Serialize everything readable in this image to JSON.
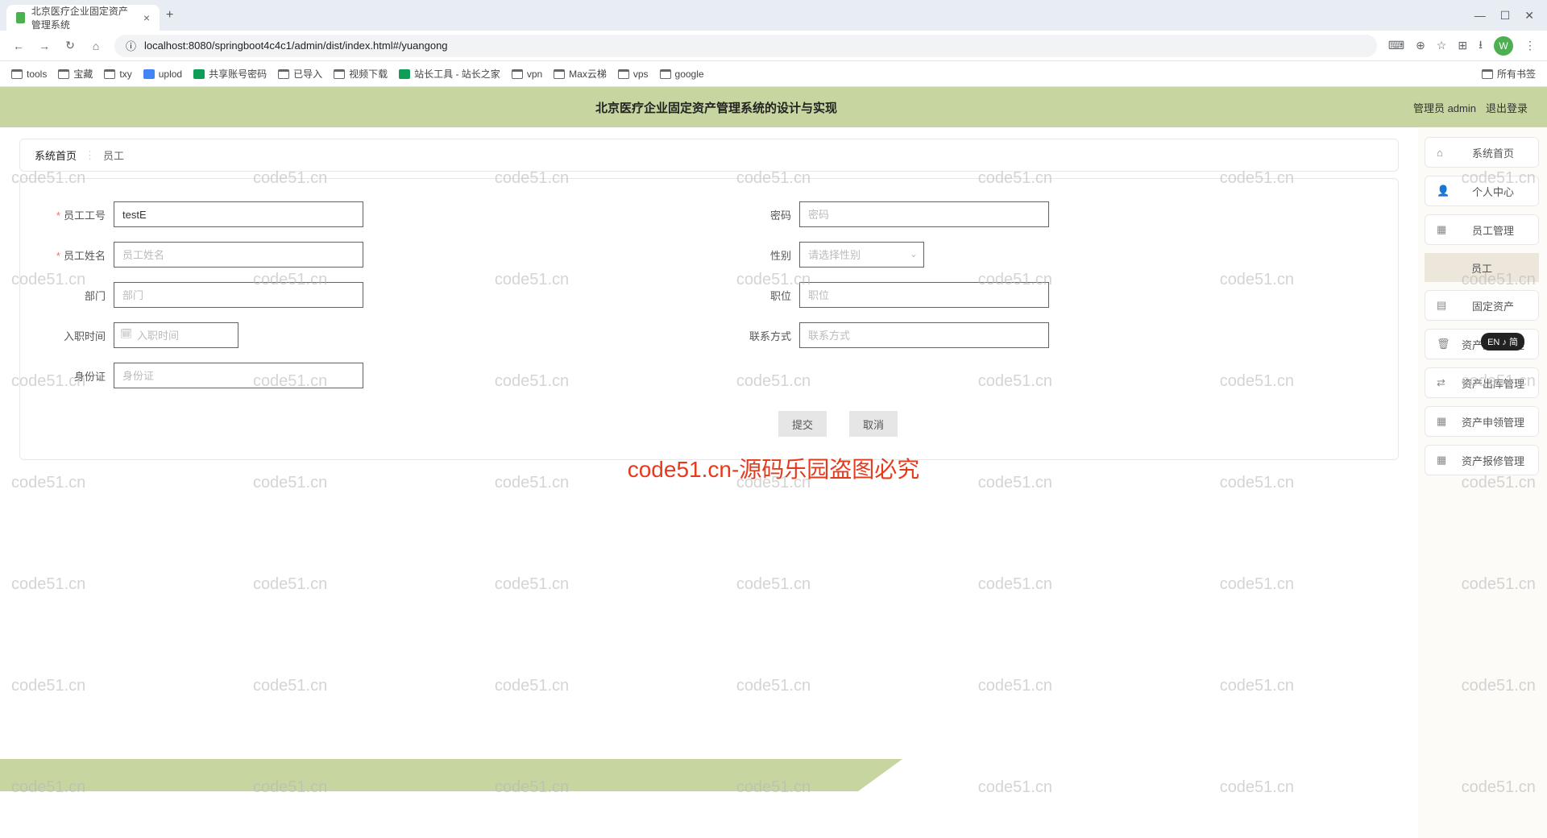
{
  "browser": {
    "tab_title": "北京医疗企业固定资产管理系统",
    "url": "localhost:8080/springboot4c4c1/admin/dist/index.html#/yuangong",
    "avatar_letter": "W"
  },
  "bookmarks": [
    "tools",
    "宝藏",
    "txy",
    "uplod",
    "共享账号密码",
    "已导入",
    "视频下载",
    "站长工具 - 站长之家",
    "vpn",
    "Max云梯",
    "vps",
    "google"
  ],
  "bookmarks_right": "所有书签",
  "header": {
    "title": "北京医疗企业固定资产管理系统的设计与实现",
    "user_label": "管理员 admin",
    "logout": "退出登录"
  },
  "breadcrumb": {
    "home": "系统首页",
    "current": "员工"
  },
  "form": {
    "employee_id": {
      "label": "员工工号",
      "value": "testE"
    },
    "password": {
      "label": "密码",
      "placeholder": "密码"
    },
    "employee_name": {
      "label": "员工姓名",
      "placeholder": "员工姓名"
    },
    "gender": {
      "label": "性别",
      "placeholder": "请选择性别"
    },
    "department": {
      "label": "部门",
      "placeholder": "部门"
    },
    "position": {
      "label": "职位",
      "placeholder": "职位"
    },
    "hire_date": {
      "label": "入职时间",
      "placeholder": "入职时间"
    },
    "contact": {
      "label": "联系方式",
      "placeholder": "联系方式"
    },
    "id_card": {
      "label": "身份证",
      "placeholder": "身份证"
    },
    "submit": "提交",
    "cancel": "取消"
  },
  "nav": {
    "items": [
      {
        "icon": "⌂",
        "label": "系统首页"
      },
      {
        "icon": "👤",
        "label": "个人中心"
      },
      {
        "icon": "▦",
        "label": "员工管理"
      },
      {
        "icon": "▤",
        "label": "固定资产"
      },
      {
        "icon": "🗑",
        "label": "资产入库管理"
      },
      {
        "icon": "⇄",
        "label": "资产出库管理"
      },
      {
        "icon": "▦",
        "label": "资产申领管理"
      },
      {
        "icon": "▦",
        "label": "资产报修管理"
      }
    ],
    "sub_active": "员工"
  },
  "watermark": "code51.cn",
  "center_notice": "code51.cn-源码乐园盗图必究",
  "ime": "EN ♪ 简"
}
